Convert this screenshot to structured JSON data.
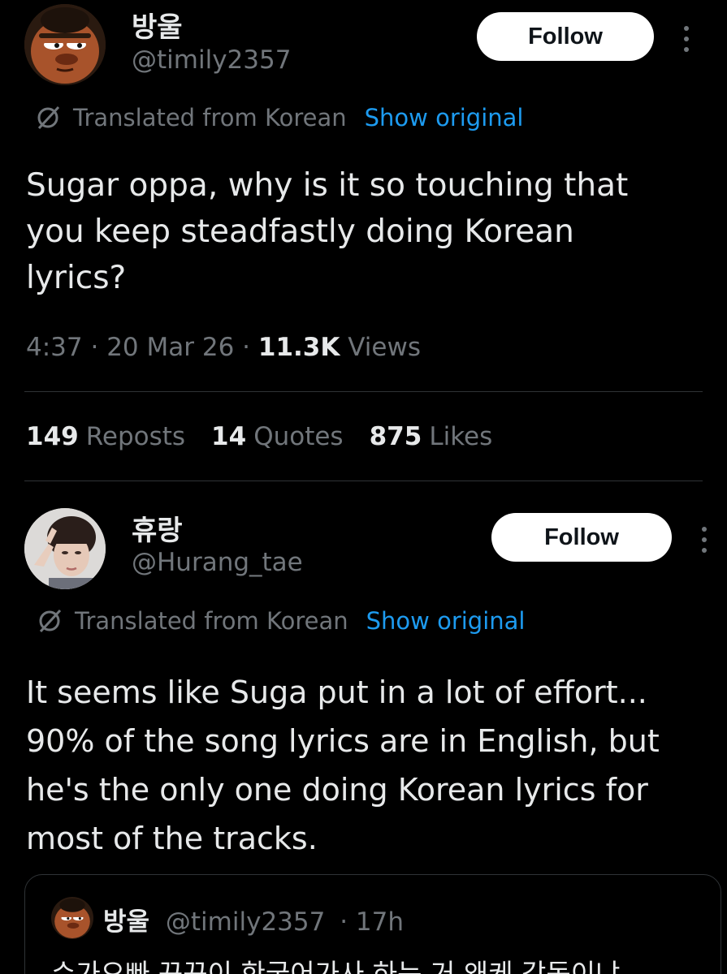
{
  "post1": {
    "name": "방울",
    "handle": "@timily2357",
    "follow_label": "Follow",
    "translated_label": "Translated from Korean",
    "show_original_label": "Show original",
    "text": "Sugar oppa, why is it so touching that you keep steadfastly doing Korean lyrics?",
    "time": "4:37",
    "date": "20 Mar 26",
    "views_count": "11.3K",
    "views_label": "Views",
    "stats": [
      {
        "count": "149",
        "label": "Reposts"
      },
      {
        "count": "14",
        "label": "Quotes"
      },
      {
        "count": "875",
        "label": "Likes"
      }
    ],
    "avatar_icon": "cartoon-character-avatar"
  },
  "post2": {
    "name": "휴랑",
    "handle": "@Hurang_tae",
    "follow_label": "Follow",
    "translated_label": "Translated from Korean",
    "show_original_label": "Show original",
    "text": "It seems like Suga put in a lot of effort... 90% of the song lyrics are in English, but he's the only one doing Korean lyrics for most of the tracks.",
    "avatar_icon": "person-photo-avatar"
  },
  "quote": {
    "name": "방울",
    "handle": "@timily2357",
    "time": "· 17h",
    "text": "슈가오빠 꾸꾸이 한국어가사 하는 거 왜케 감동이냐"
  },
  "colors": {
    "background": "#000000",
    "text": "#e7e9ea",
    "muted": "#71767b",
    "link": "#1d9bf0",
    "divider": "#2f3336"
  }
}
